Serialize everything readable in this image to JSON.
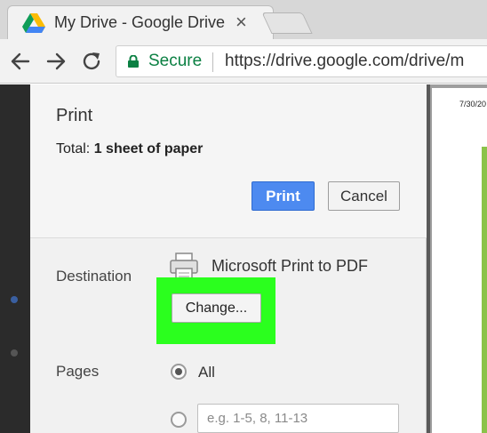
{
  "browser": {
    "tab_title": "My Drive - Google Drive",
    "tab_close": "×",
    "favicon": "google-drive-icon",
    "secure_label": "Secure",
    "url": "https://drive.google.com/drive/m",
    "secure_color": "#0b8043"
  },
  "print_dialog": {
    "title": "Print",
    "total_label": "Total:",
    "total_value": "1 sheet of paper",
    "print_button": "Print",
    "cancel_button": "Cancel",
    "destination_label": "Destination",
    "destination_name": "Microsoft Print to PDF",
    "change_button": "Change...",
    "pages_label": "Pages",
    "pages_options": [
      {
        "label": "All",
        "selected": true
      },
      {
        "placeholder": "e.g. 1-5, 8, 11-13",
        "selected": false
      }
    ],
    "accent_color": "#4d8af0",
    "highlight_color": "#2bff1e"
  },
  "preview": {
    "date_text": "7/30/20"
  }
}
